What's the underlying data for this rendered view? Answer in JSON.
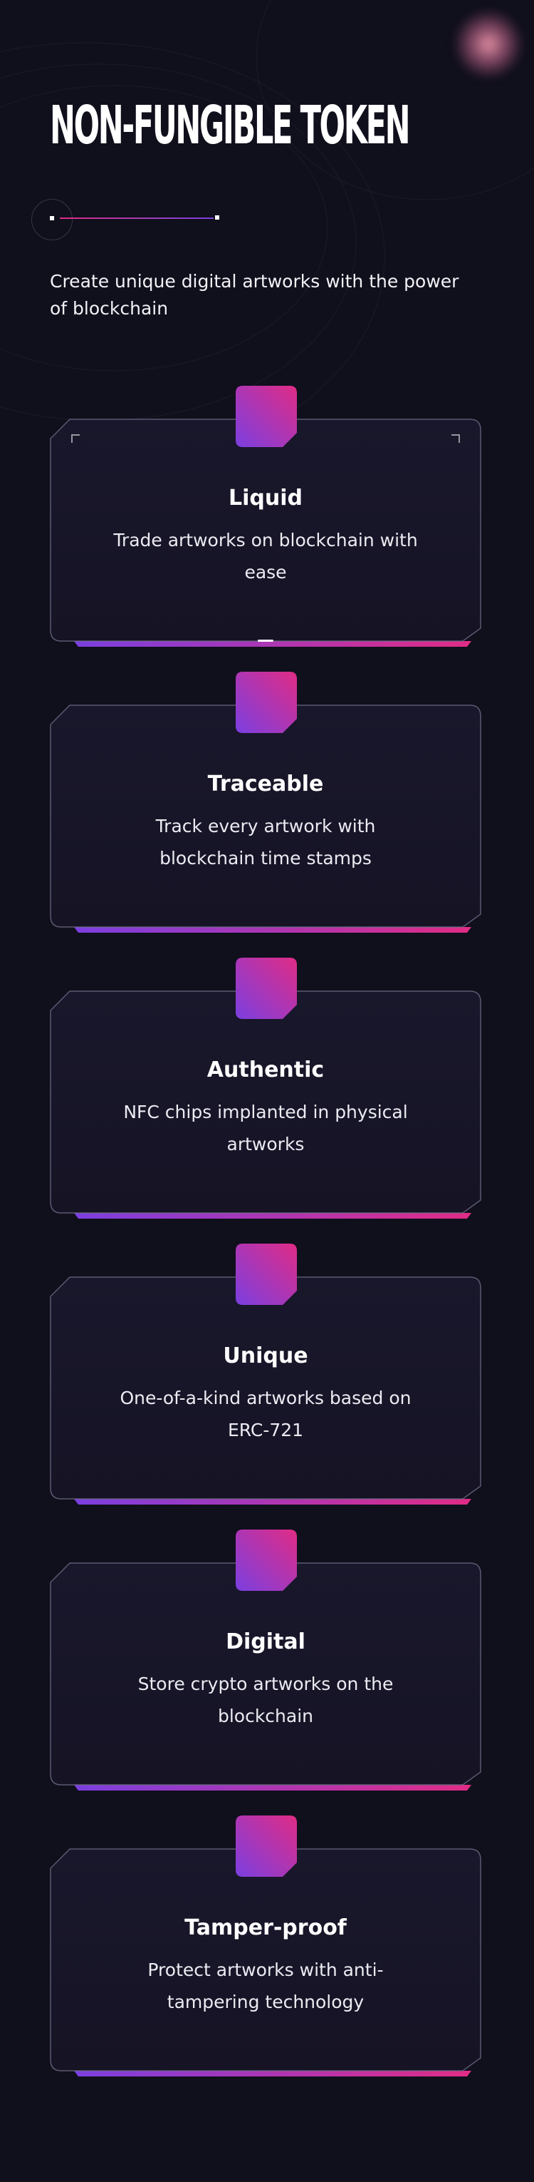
{
  "hero": {
    "title": "NON-FUNGIBLE TOKEN",
    "subtitle": "Create unique digital artworks with the power of blockchain"
  },
  "colors": {
    "background": "#100f1c",
    "card_background": "#19172b",
    "card_border": "#6e6c86",
    "accent_pink": "#e02c86",
    "accent_purple": "#7b3fe0"
  },
  "features": [
    {
      "title": "Liquid",
      "description": "Trade artworks on blockchain with ease"
    },
    {
      "title": "Traceable",
      "description": "Track every artwork with blockchain time stamps"
    },
    {
      "title": "Authentic",
      "description": "NFC chips implanted in physical artworks"
    },
    {
      "title": "Unique",
      "description": "One-of-a-kind artworks based on ERC-721"
    },
    {
      "title": "Digital",
      "description": "Store crypto artworks on the blockchain"
    },
    {
      "title": "Tamper-proof",
      "description": "Protect artworks with anti-tampering technology"
    }
  ]
}
